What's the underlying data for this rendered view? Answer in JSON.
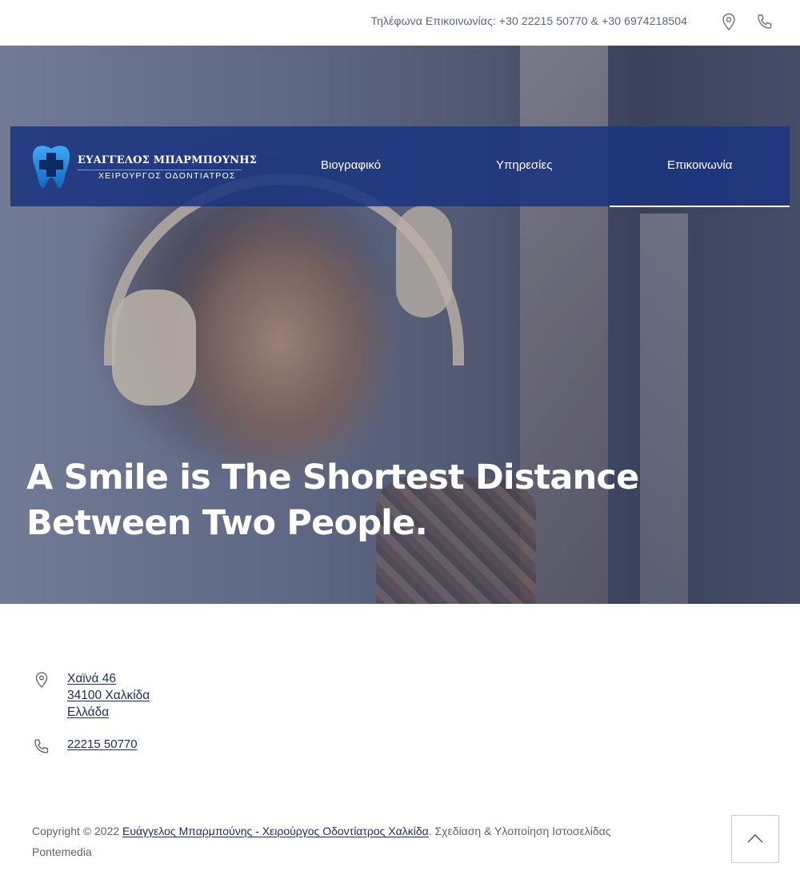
{
  "topbar": {
    "phones": "Τηλέφωνα Επικοινωνίας: +30 22215 50770 & +30 6974218504",
    "location_icon": "map-pin-icon",
    "phone_icon": "phone-icon"
  },
  "logo": {
    "name": "ΕΥΑΓΓΕΛΟΣ ΜΠΑΡΜΠΟΥΝΗΣ",
    "subtitle": "ΧΕΙΡΟΥΡΓΟΣ ΟΔΟΝΤΙΑΤΡΟΣ",
    "icon": "tooth-cross-icon"
  },
  "nav": {
    "items": [
      {
        "label": "Βιογραφικό"
      },
      {
        "label": "Υπηρεσίες"
      },
      {
        "label": "Επικοινωνία",
        "active": true
      }
    ]
  },
  "hero": {
    "headline": "A Smile is The Shortest Distance Between Two People."
  },
  "contact": {
    "address_line1": "Χαϊνά 46",
    "address_line2": "34100 Χαλκίδα",
    "address_line3": "Ελλάδα",
    "phone": "22215 50770"
  },
  "footer": {
    "prefix": "Copyright © 2022 ",
    "site_link": "Ευάγγελος Μπαρμπούνης - Χειρούργος Οδοντίατρος Χαλκίδα",
    "suffix": ". Σχεδίαση & Υλοποίηση Ιστοσελίδας",
    "credit": "Pontemedia",
    "scroll_top_icon": "chevron-up-icon"
  },
  "colors": {
    "nav_bg": "#1b3480",
    "link": "#1e2d6b",
    "text": "#5c6474"
  }
}
